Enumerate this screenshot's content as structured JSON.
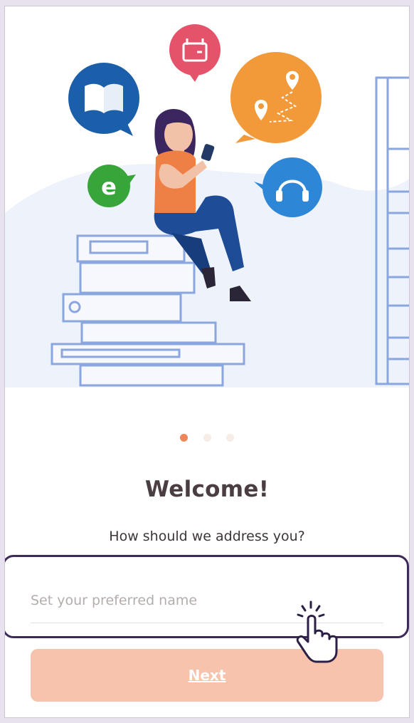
{
  "onboarding": {
    "page_indicator": {
      "total": 3,
      "active_index": 0
    },
    "title": "Welcome!",
    "subtitle": "How should we address you?",
    "name_input": {
      "placeholder": "Set your preferred name",
      "value": ""
    },
    "next_label": "Next"
  },
  "colors": {
    "accent": "#ee8659",
    "button_bg": "#f8c3ad",
    "highlight_border": "#3d2a5b",
    "title_text": "#4a3e42"
  },
  "icons": [
    "calendar-icon",
    "book-icon",
    "map-route-icon",
    "e-letter-icon",
    "headphones-icon",
    "tap-cursor-icon"
  ]
}
